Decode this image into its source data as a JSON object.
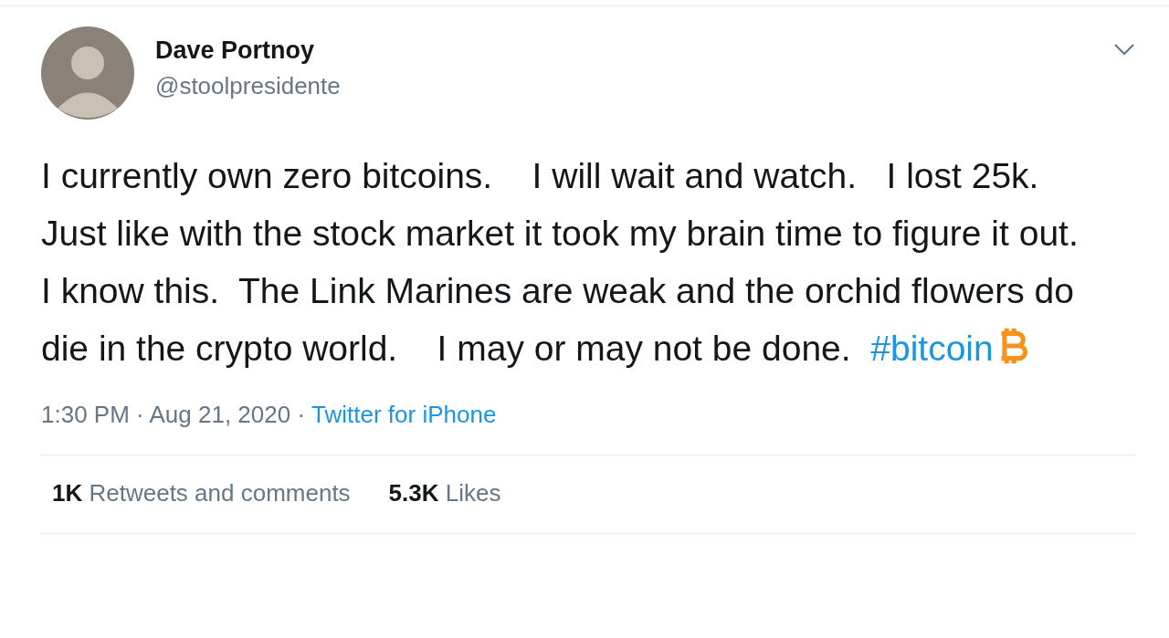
{
  "author": {
    "name": "Dave Portnoy",
    "handle": "@stoolpresidente"
  },
  "tweet": {
    "text": "I currently own zero bitcoins.    I will wait and watch.   I lost 25k.  Just like with the stock market it took my brain time to figure it out.   I know this.  The Link Marines are weak and the orchid flowers do die in the crypto world.    I may or may not be done.  ",
    "hashtag": "#bitcoin"
  },
  "meta": {
    "text": "1:30 PM · Aug 21, 2020 ·",
    "source": "Twitter for iPhone"
  },
  "stats": [
    {
      "text": "**1K** Retweets and comments"
    },
    {
      "text": "**5.3K** Likes"
    }
  ]
}
